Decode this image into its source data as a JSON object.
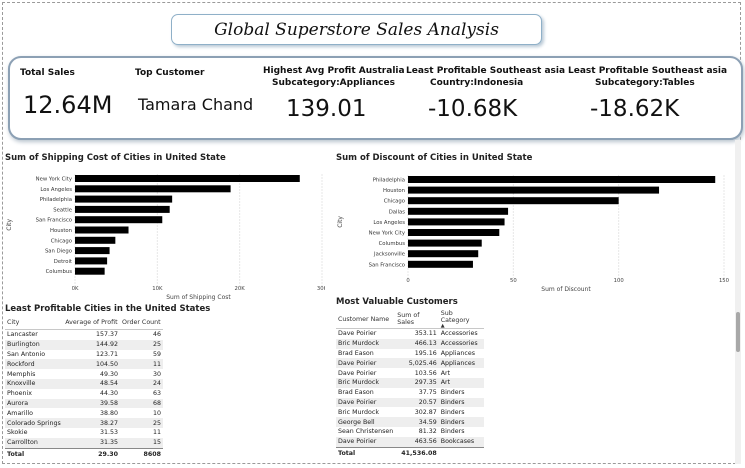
{
  "title": "Global Superstore Sales Analysis",
  "kpis": {
    "total_sales": {
      "label": "Total Sales",
      "value": "12.64M"
    },
    "top_customer": {
      "label": "Top Customer",
      "value": "Tamara Chand"
    },
    "avg_profit": {
      "label1": "Highest Avg Profit Australia",
      "label2": "Subcategory:Appliances",
      "value": "139.01"
    },
    "country": {
      "label1": "Least Profitable Southeast asia",
      "label2": "Country:Indonesia",
      "value": "-10.68K"
    },
    "subcategory": {
      "label1": "Least Profitable Southeast asia",
      "label2": "Subcategory:Tables",
      "value": "-18.62K"
    }
  },
  "chart_data": [
    {
      "type": "bar",
      "orientation": "horizontal",
      "title": "Sum of Shipping Cost of Cities in United State",
      "ylabel": "City",
      "xlabel": "Sum of Shipping Cost",
      "categories": [
        "New York City",
        "Los Angeles",
        "Philadelphia",
        "Seattle",
        "San Francisco",
        "Houston",
        "Chicago",
        "San Diego",
        "Detroit",
        "Columbus"
      ],
      "values": [
        27300,
        18900,
        11800,
        11500,
        10600,
        6500,
        4900,
        4200,
        3900,
        3600
      ],
      "xlim": [
        0,
        30000
      ],
      "xticks": [
        "0K",
        "10K",
        "20K",
        "30K"
      ],
      "color": "#000000"
    },
    {
      "type": "bar",
      "orientation": "horizontal",
      "title": "Sum of Discount of Cities in United State",
      "ylabel": "City",
      "xlabel": "Sum of Discount",
      "categories": [
        "Philadelphia",
        "Houston",
        "Chicago",
        "Dallas",
        "Los Angeles",
        "New York City",
        "Columbus",
        "Jacksonville",
        "San Francisco"
      ],
      "values": [
        175,
        143,
        120,
        57,
        55,
        52,
        42,
        40,
        37
      ],
      "xlim": [
        0,
        180
      ],
      "xticks": [
        "0",
        "50",
        "100",
        "150"
      ],
      "color": "#000000"
    }
  ],
  "cities_table": {
    "title": "Least Profitable Cities in the United States",
    "headers": [
      "City",
      "Average of Profit",
      "Order Count"
    ],
    "rows": [
      [
        "Lancaster",
        "157.37",
        "46"
      ],
      [
        "Burlington",
        "144.92",
        "25"
      ],
      [
        "San Antonio",
        "123.71",
        "59"
      ],
      [
        "Rockford",
        "104.50",
        "11"
      ],
      [
        "Memphis",
        "49.30",
        "30"
      ],
      [
        "Knoxville",
        "48.54",
        "24"
      ],
      [
        "Phoenix",
        "44.30",
        "63"
      ],
      [
        "Aurora",
        "39.58",
        "68"
      ],
      [
        "Amarillo",
        "38.80",
        "10"
      ],
      [
        "Colorado Springs",
        "38.27",
        "25"
      ],
      [
        "Skokie",
        "31.53",
        "11"
      ],
      [
        "Carrollton",
        "31.35",
        "15"
      ]
    ],
    "total": [
      "Total",
      "29.30",
      "8608"
    ]
  },
  "customers_table": {
    "title": "Most Valuable Customers",
    "headers": [
      "Customer Name",
      "Sum of Sales",
      "Sub Category"
    ],
    "rows": [
      [
        "Dave Poirier",
        "353.11",
        "Accessories"
      ],
      [
        "Bric Murdock",
        "466.13",
        "Accessories"
      ],
      [
        "Brad Eason",
        "195.16",
        "Appliances"
      ],
      [
        "Dave Poirier",
        "5,025.46",
        "Appliances"
      ],
      [
        "Dave Poirier",
        "103.56",
        "Art"
      ],
      [
        "Bric Murdock",
        "297.35",
        "Art"
      ],
      [
        "Brad Eason",
        "37.75",
        "Binders"
      ],
      [
        "Dave Poirier",
        "20.57",
        "Binders"
      ],
      [
        "Bric Murdock",
        "302.87",
        "Binders"
      ],
      [
        "George Bell",
        "34.59",
        "Binders"
      ],
      [
        "Sean Christensen",
        "81.32",
        "Binders"
      ],
      [
        "Dave Poirier",
        "463.56",
        "Bookcases"
      ]
    ],
    "total": [
      "Total",
      "41,536.08",
      ""
    ]
  }
}
